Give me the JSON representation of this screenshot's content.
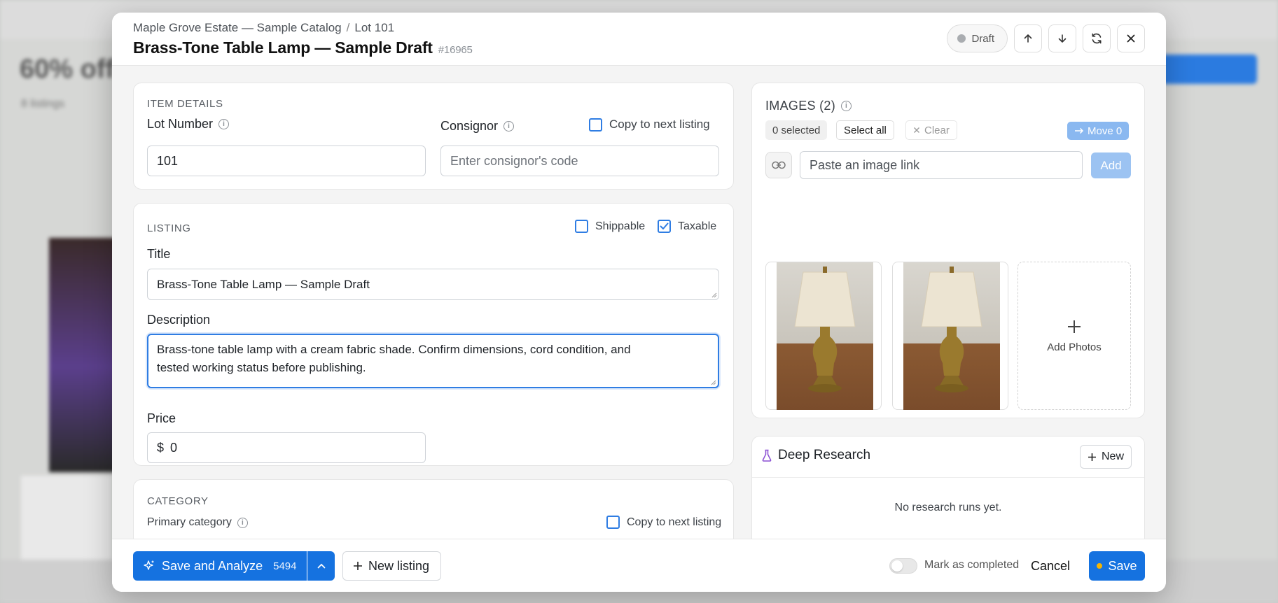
{
  "header": {
    "breadcrumb_catalog": "Maple Grove Estate — Sample Catalog",
    "breadcrumb_separator": "/",
    "breadcrumb_lot": "Lot 101",
    "title": "Brass-Tone Table Lamp — Sample Draft",
    "item_id": "#16965",
    "status_label": "Draft",
    "icons": [
      "arrow-up-icon",
      "arrow-down-icon",
      "refresh-icon",
      "close-icon"
    ]
  },
  "item_details": {
    "section_label": "ITEM DETAILS",
    "lot_number_label": "Lot Number",
    "lot_number_value": "101",
    "consignor_label": "Consignor",
    "consignor_placeholder": "Enter consignor's code",
    "copy_next_label": "Copy to next listing",
    "copy_next_checked": false
  },
  "listing": {
    "section_label": "LISTING",
    "shippable_label": "Shippable",
    "shippable_checked": false,
    "taxable_label": "Taxable",
    "taxable_checked": true,
    "title_label": "Title",
    "title_value": "Brass-Tone Table Lamp — Sample Draft",
    "description_label": "Description",
    "description_line1": "Brass-tone table lamp with a cream fabric shade. Confirm dimensions, cord condition, and",
    "description_line2": "tested working status before publishing.",
    "price_label": "Price",
    "price_currency": "$",
    "price_value": "0"
  },
  "category": {
    "section_label": "CATEGORY",
    "primary_label": "Primary category",
    "copy_next_label": "Copy to next listing",
    "copy_next_checked": false
  },
  "images": {
    "section_label": "IMAGES (2)",
    "selected_label": "0 selected",
    "select_all_label": "Select all",
    "clear_label": "Clear",
    "move_label": "Move 0",
    "link_placeholder": "Paste an image link",
    "add_label": "Add",
    "add_photos_label": "Add Photos",
    "count": 2
  },
  "research": {
    "title": "Deep Research",
    "new_label": "New",
    "empty_text": "No research runs yet."
  },
  "footer": {
    "save_analyze_label": "Save and Analyze",
    "save_analyze_count": "5494",
    "new_listing_label": "New listing",
    "mark_completed_label": "Mark as completed",
    "mark_completed_on": false,
    "cancel_label": "Cancel",
    "save_label": "Save"
  },
  "colors": {
    "accent": "#1572e0",
    "save_dot": "#f5b400"
  }
}
